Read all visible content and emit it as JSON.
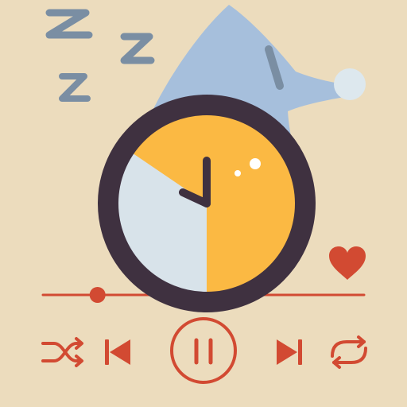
{
  "player": {
    "progress": 0.17,
    "state": "paused",
    "liked": true
  },
  "controls": {
    "shuffle_icon": "shuffle-icon",
    "previous_icon": "skip-previous-icon",
    "play_pause_icon": "pause-icon",
    "next_icon": "skip-next-icon",
    "repeat_icon": "repeat-icon",
    "favorite_icon": "heart-icon"
  },
  "illustration": {
    "clock_icon": "alarm-clock-icon",
    "hat_icon": "sleeping-cap-icon",
    "sleep_icon": "zzz-icon"
  },
  "colors": {
    "background": "#ecdcbd",
    "accent": "#d24a32",
    "clock_rim": "#3f3140",
    "clock_face": "#fbb943",
    "clock_sector": "#d8e3ea",
    "cap": "#a6bfdc",
    "zzz": "#7a8ea3",
    "pompom": "#dde8ee"
  }
}
